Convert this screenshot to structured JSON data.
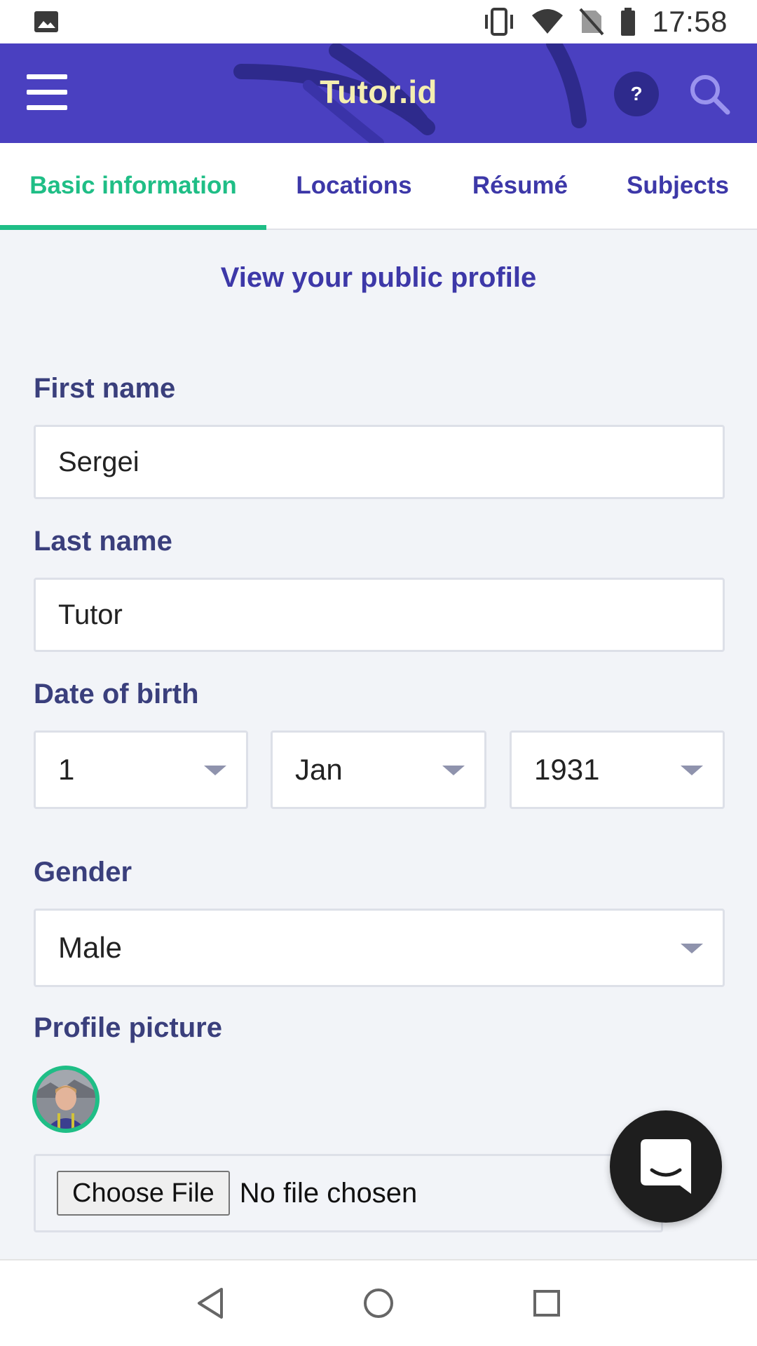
{
  "status_bar": {
    "time": "17:58",
    "icons": [
      "image-icon",
      "vibrate-icon",
      "wifi-icon",
      "no-sim-icon",
      "battery-icon"
    ]
  },
  "app_bar": {
    "title": "Tutor.id",
    "help_label": "?",
    "icons": [
      "menu-icon",
      "help-icon",
      "search-icon"
    ],
    "colors": {
      "background": "#4a40c0",
      "title": "#f4eeb0"
    }
  },
  "tabs": [
    {
      "label": "Basic information",
      "active": true
    },
    {
      "label": "Locations",
      "active": false
    },
    {
      "label": "Résumé",
      "active": false
    },
    {
      "label": "Subjects",
      "active": false
    }
  ],
  "main": {
    "public_profile_link": "View your public profile",
    "first_name": {
      "label": "First name",
      "value": "Sergei"
    },
    "last_name": {
      "label": "Last name",
      "value": "Tutor"
    },
    "date_of_birth": {
      "label": "Date of birth",
      "day": "1",
      "month": "Jan",
      "year": "1931"
    },
    "gender": {
      "label": "Gender",
      "value": "Male"
    },
    "profile_picture": {
      "label": "Profile picture",
      "choose_button": "Choose File",
      "file_status": "No file chosen"
    }
  },
  "colors": {
    "accent_green": "#1fbe86",
    "tab_text": "#3d38a8",
    "label_text": "#3a3f7c"
  },
  "nav_bar": {
    "icons": [
      "back-icon",
      "home-icon",
      "recents-icon"
    ]
  }
}
